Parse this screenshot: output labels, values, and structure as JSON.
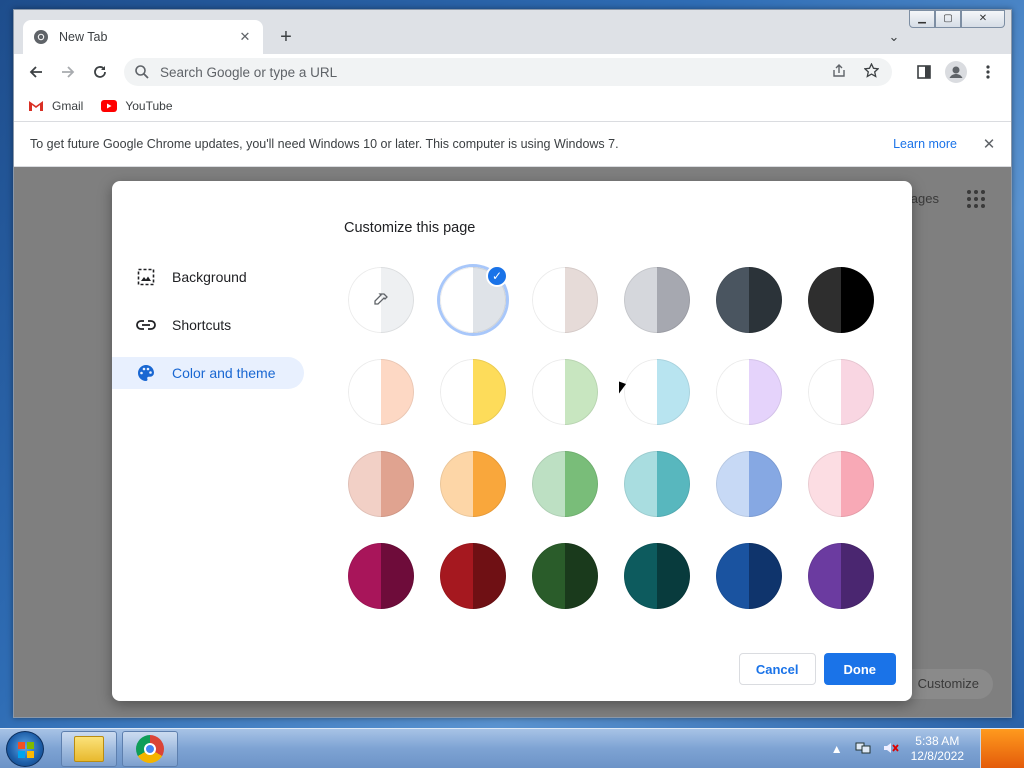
{
  "browser": {
    "tab_title": "New Tab",
    "tab_close": "✕",
    "new_tab": "+",
    "tab_search": "⌄",
    "omnibox_placeholder": "Search Google or type a URL",
    "bookmarks": [
      {
        "label": "Gmail",
        "icon": "gmail-icon"
      },
      {
        "label": "YouTube",
        "icon": "youtube-icon"
      }
    ],
    "infobar": {
      "text": "To get future Google Chrome updates, you'll need Windows 10 or later. This computer is using Windows 7.",
      "link": "Learn more",
      "close": "✕"
    },
    "window_controls": {
      "minimize": "▁",
      "maximize": "▢",
      "close": "✕"
    }
  },
  "ntp": {
    "images_link": "Images",
    "customize_label": "Customize Chrome"
  },
  "dialog": {
    "title": "Customize this page",
    "menu": [
      {
        "label": "Background",
        "icon": "background-icon",
        "active": false
      },
      {
        "label": "Shortcuts",
        "icon": "link-icon",
        "active": false
      },
      {
        "label": "Color and theme",
        "icon": "palette-icon",
        "active": true
      }
    ],
    "swatches": [
      {
        "left": "#ffffff",
        "right": "#eef0f2",
        "type": "picker"
      },
      {
        "left": "#ffffff",
        "right": "#dfe3e8",
        "selected": true
      },
      {
        "left": "#ffffff",
        "right": "#e6dbd8"
      },
      {
        "left": "#d5d7dc",
        "right": "#a6a8b0"
      },
      {
        "left": "#4a5560",
        "right": "#2b3339"
      },
      {
        "left": "#2e2e2e",
        "right": "#000000"
      },
      {
        "left": "#ffffff",
        "right": "#fdd8c4"
      },
      {
        "left": "#ffffff",
        "right": "#fddc5a"
      },
      {
        "left": "#ffffff",
        "right": "#c8e6c0"
      },
      {
        "left": "#ffffff",
        "right": "#b8e4f0"
      },
      {
        "left": "#ffffff",
        "right": "#e5d3fb"
      },
      {
        "left": "#ffffff",
        "right": "#f9d6e2"
      },
      {
        "left": "#f2d0c6",
        "right": "#e0a390"
      },
      {
        "left": "#fdd6a7",
        "right": "#f9a73c"
      },
      {
        "left": "#bde0c3",
        "right": "#79bd79"
      },
      {
        "left": "#a9dde0",
        "right": "#58b7be"
      },
      {
        "left": "#c7d9f5",
        "right": "#86a8e3"
      },
      {
        "left": "#fcdde3",
        "right": "#f8a9b6"
      },
      {
        "left": "#a8155a",
        "right": "#6e0c3a"
      },
      {
        "left": "#a5181f",
        "right": "#6f1014"
      },
      {
        "left": "#2a5c2a",
        "right": "#1a3a1c"
      },
      {
        "left": "#0d5b5e",
        "right": "#083b3d"
      },
      {
        "left": "#1a53a0",
        "right": "#0f346c"
      },
      {
        "left": "#6b3ba0",
        "right": "#4a2670"
      }
    ],
    "cancel_label": "Cancel",
    "done_label": "Done"
  },
  "taskbar": {
    "time": "5:38 AM",
    "date": "12/8/2022",
    "tray_arrow": "▲"
  },
  "colors": {
    "accent": "#1a73e8",
    "active_menu_bg": "#e8f0fe",
    "overlay": "#7f7f7f"
  }
}
